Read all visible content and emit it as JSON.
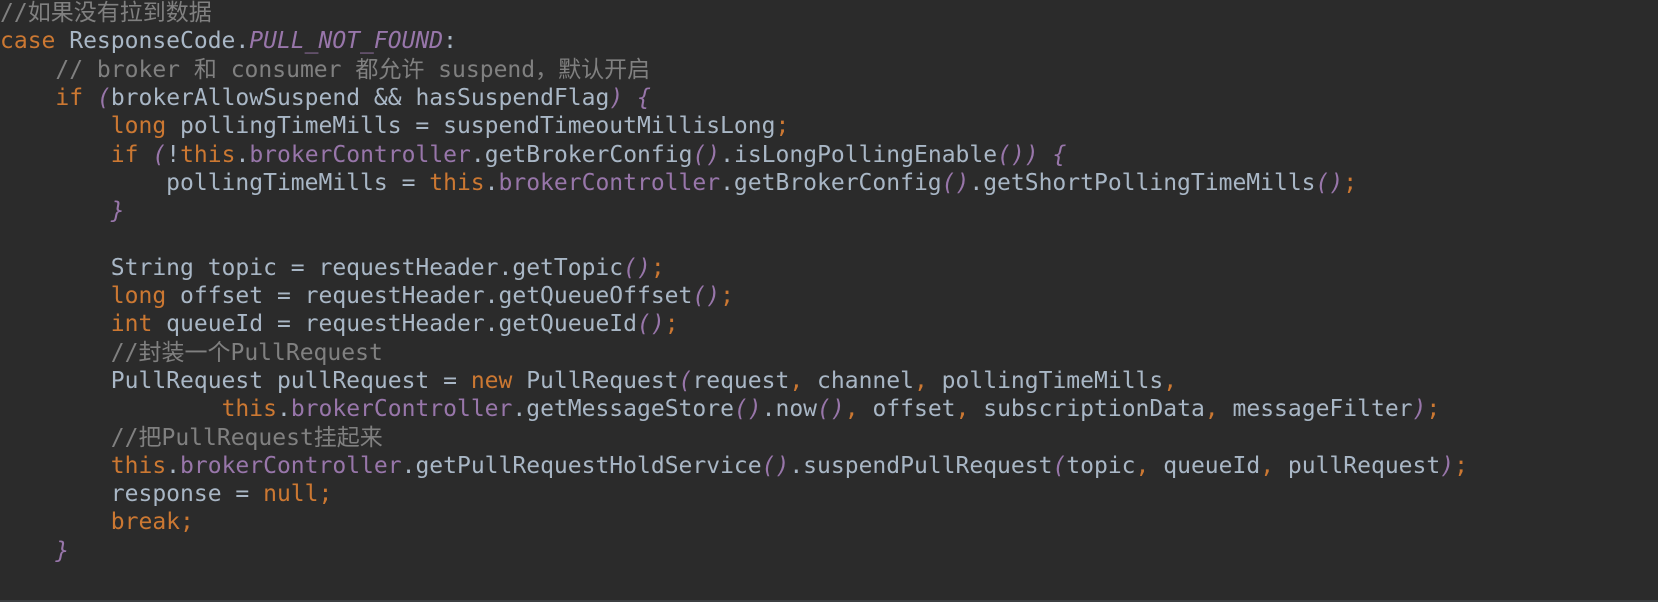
{
  "colors": {
    "background": "#2b2b2b",
    "default": "#a9b7c6",
    "keyword": "#cc7832",
    "comment": "#808080",
    "field": "#9876aa"
  },
  "code": {
    "lines": [
      {
        "tokens": [
          {
            "t": "//如果没有拉到数据",
            "c": "comment"
          }
        ]
      },
      {
        "tokens": [
          {
            "t": "case",
            "c": "keyword"
          },
          {
            "t": " ResponseCode.",
            "c": "default"
          },
          {
            "t": "PULL_NOT_FOUND",
            "c": "static"
          },
          {
            "t": ":",
            "c": "default"
          }
        ]
      },
      {
        "tokens": [
          {
            "t": "    // broker 和 consumer 都允许 suspend，默认开启",
            "c": "comment"
          }
        ]
      },
      {
        "tokens": [
          {
            "t": "    ",
            "c": "default"
          },
          {
            "t": "if",
            "c": "keyword"
          },
          {
            "t": " ",
            "c": "default"
          },
          {
            "t": "(",
            "c": "paren"
          },
          {
            "t": "brokerAllowSuspend && hasSuspendFlag",
            "c": "default"
          },
          {
            "t": ")",
            "c": "paren"
          },
          {
            "t": " ",
            "c": "default"
          },
          {
            "t": "{",
            "c": "brace"
          }
        ]
      },
      {
        "tokens": [
          {
            "t": "        ",
            "c": "default"
          },
          {
            "t": "long",
            "c": "keyword"
          },
          {
            "t": " pollingTimeMills = suspendTimeoutMillisLong",
            "c": "default"
          },
          {
            "t": ";",
            "c": "punct"
          }
        ]
      },
      {
        "tokens": [
          {
            "t": "        ",
            "c": "default"
          },
          {
            "t": "if",
            "c": "keyword"
          },
          {
            "t": " ",
            "c": "default"
          },
          {
            "t": "(",
            "c": "paren"
          },
          {
            "t": "!",
            "c": "default"
          },
          {
            "t": "this",
            "c": "keyword"
          },
          {
            "t": ".",
            "c": "default"
          },
          {
            "t": "brokerController",
            "c": "field"
          },
          {
            "t": ".getBrokerConfig",
            "c": "default"
          },
          {
            "t": "()",
            "c": "paren"
          },
          {
            "t": ".isLongPollingEnable",
            "c": "default"
          },
          {
            "t": "())",
            "c": "paren"
          },
          {
            "t": " ",
            "c": "default"
          },
          {
            "t": "{",
            "c": "brace"
          }
        ]
      },
      {
        "tokens": [
          {
            "t": "            pollingTimeMills = ",
            "c": "default"
          },
          {
            "t": "this",
            "c": "keyword"
          },
          {
            "t": ".",
            "c": "default"
          },
          {
            "t": "brokerController",
            "c": "field"
          },
          {
            "t": ".getBrokerConfig",
            "c": "default"
          },
          {
            "t": "()",
            "c": "paren"
          },
          {
            "t": ".getShortPollingTimeMills",
            "c": "default"
          },
          {
            "t": "()",
            "c": "paren"
          },
          {
            "t": ";",
            "c": "punct"
          }
        ]
      },
      {
        "tokens": [
          {
            "t": "        ",
            "c": "default"
          },
          {
            "t": "}",
            "c": "brace"
          }
        ]
      },
      {
        "tokens": []
      },
      {
        "tokens": [
          {
            "t": "        String topic = requestHeader.getTopic",
            "c": "default"
          },
          {
            "t": "()",
            "c": "paren"
          },
          {
            "t": ";",
            "c": "punct"
          }
        ]
      },
      {
        "tokens": [
          {
            "t": "        ",
            "c": "default"
          },
          {
            "t": "long",
            "c": "keyword"
          },
          {
            "t": " offset = requestHeader.getQueueOffset",
            "c": "default"
          },
          {
            "t": "()",
            "c": "paren"
          },
          {
            "t": ";",
            "c": "punct"
          }
        ]
      },
      {
        "tokens": [
          {
            "t": "        ",
            "c": "default"
          },
          {
            "t": "int",
            "c": "keyword"
          },
          {
            "t": " queueId = requestHeader.getQueueId",
            "c": "default"
          },
          {
            "t": "()",
            "c": "paren"
          },
          {
            "t": ";",
            "c": "punct"
          }
        ]
      },
      {
        "tokens": [
          {
            "t": "        //封装一个PullRequest",
            "c": "comment"
          }
        ]
      },
      {
        "tokens": [
          {
            "t": "        PullRequest pullRequest = ",
            "c": "default"
          },
          {
            "t": "new",
            "c": "keyword"
          },
          {
            "t": " PullRequest",
            "c": "default"
          },
          {
            "t": "(",
            "c": "paren"
          },
          {
            "t": "request",
            "c": "default"
          },
          {
            "t": ",",
            "c": "punct"
          },
          {
            "t": " channel",
            "c": "default"
          },
          {
            "t": ",",
            "c": "punct"
          },
          {
            "t": " pollingTimeMills",
            "c": "default"
          },
          {
            "t": ",",
            "c": "punct"
          }
        ]
      },
      {
        "tokens": [
          {
            "t": "                ",
            "c": "default"
          },
          {
            "t": "this",
            "c": "keyword"
          },
          {
            "t": ".",
            "c": "default"
          },
          {
            "t": "brokerController",
            "c": "field"
          },
          {
            "t": ".getMessageStore",
            "c": "default"
          },
          {
            "t": "()",
            "c": "paren"
          },
          {
            "t": ".now",
            "c": "default"
          },
          {
            "t": "()",
            "c": "paren"
          },
          {
            "t": ",",
            "c": "punct"
          },
          {
            "t": " offset",
            "c": "default"
          },
          {
            "t": ",",
            "c": "punct"
          },
          {
            "t": " subscriptionData",
            "c": "default"
          },
          {
            "t": ",",
            "c": "punct"
          },
          {
            "t": " messageFilter",
            "c": "default"
          },
          {
            "t": ")",
            "c": "paren"
          },
          {
            "t": ";",
            "c": "punct"
          }
        ]
      },
      {
        "tokens": [
          {
            "t": "        //把PullRequest挂起来",
            "c": "comment"
          }
        ]
      },
      {
        "tokens": [
          {
            "t": "        ",
            "c": "default"
          },
          {
            "t": "this",
            "c": "keyword"
          },
          {
            "t": ".",
            "c": "default"
          },
          {
            "t": "brokerController",
            "c": "field"
          },
          {
            "t": ".getPullRequestHoldService",
            "c": "default"
          },
          {
            "t": "()",
            "c": "paren"
          },
          {
            "t": ".suspendPullRequest",
            "c": "default"
          },
          {
            "t": "(",
            "c": "paren"
          },
          {
            "t": "topic",
            "c": "default"
          },
          {
            "t": ",",
            "c": "punct"
          },
          {
            "t": " queueId",
            "c": "default"
          },
          {
            "t": ",",
            "c": "punct"
          },
          {
            "t": " pullRequest",
            "c": "default"
          },
          {
            "t": ")",
            "c": "paren"
          },
          {
            "t": ";",
            "c": "punct"
          }
        ]
      },
      {
        "tokens": [
          {
            "t": "        response = ",
            "c": "default"
          },
          {
            "t": "null",
            "c": "keyword"
          },
          {
            "t": ";",
            "c": "punct"
          }
        ]
      },
      {
        "tokens": [
          {
            "t": "        ",
            "c": "default"
          },
          {
            "t": "break",
            "c": "keyword"
          },
          {
            "t": ";",
            "c": "punct"
          }
        ]
      },
      {
        "tokens": [
          {
            "t": "    ",
            "c": "default"
          },
          {
            "t": "}",
            "c": "brace"
          }
        ]
      }
    ]
  }
}
